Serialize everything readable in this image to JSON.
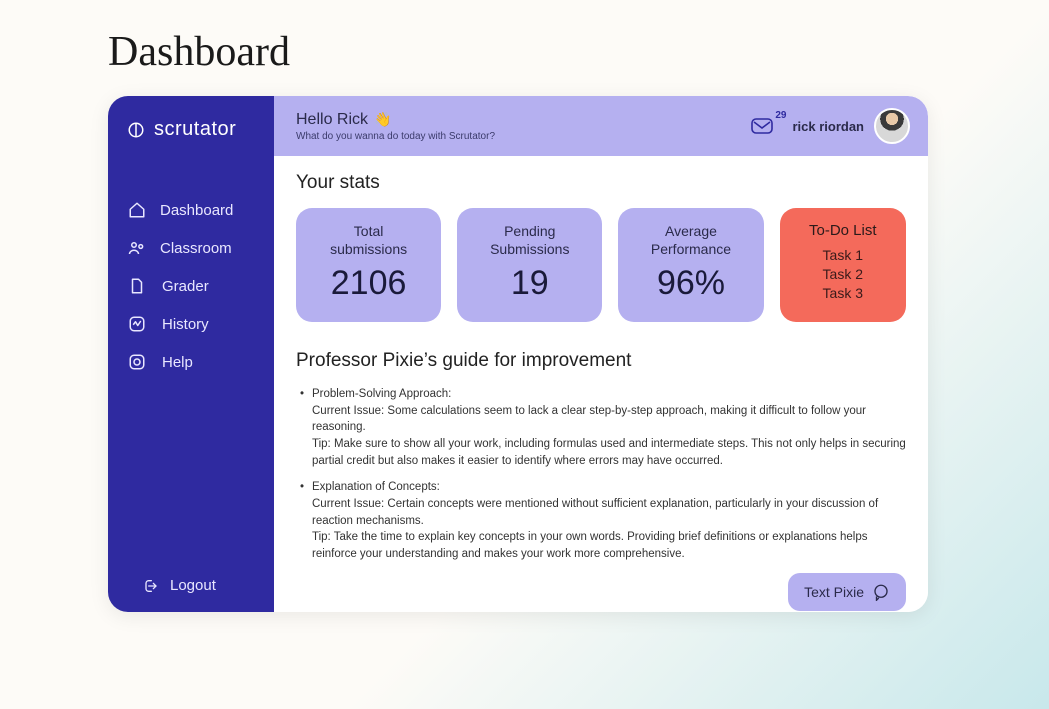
{
  "page": {
    "title": "Dashboard"
  },
  "brand": {
    "name": "scrutator"
  },
  "nav": {
    "items": [
      {
        "label": "Dashboard"
      },
      {
        "label": "Classroom"
      },
      {
        "label": "Grader"
      },
      {
        "label": "History"
      },
      {
        "label": "Help"
      }
    ],
    "logout": "Logout"
  },
  "header": {
    "greeting": "Hello Rick",
    "wave": "👋",
    "sub": "What do you wanna do today with Scrutator?",
    "inbox_count": "29",
    "username": "rick riordan"
  },
  "stats": {
    "title": "Your stats",
    "cards": [
      {
        "label_line1": "Total",
        "label_line2": "submissions",
        "value": "2106"
      },
      {
        "label_line1": "Pending",
        "label_line2": "Submissions",
        "value": "19"
      },
      {
        "label_line1": "Average",
        "label_line2": "Performance",
        "value": "96%"
      }
    ],
    "todo": {
      "title": "To-Do List",
      "items": [
        "Task 1",
        "Task 2",
        "Task 3"
      ]
    }
  },
  "guide": {
    "title": "Professor Pixie’s guide for improvement",
    "points": [
      {
        "heading": "Problem-Solving Approach:",
        "issue": "Current Issue: Some calculations seem to lack a clear step-by-step approach, making it difficult to follow your reasoning.",
        "tip": "Tip: Make sure to show all your work, including formulas used and intermediate steps. This not only helps in securing partial credit but also makes it easier to identify where errors may have occurred."
      },
      {
        "heading": "Explanation of Concepts:",
        "issue": "Current Issue: Certain concepts were mentioned without sufficient explanation, particularly in your discussion of reaction mechanisms.",
        "tip": "Tip: Take the time to explain key concepts in your own words. Providing brief definitions or explanations helps reinforce your understanding and makes your work more comprehensive."
      }
    ]
  },
  "pixie_button": "Text Pixie"
}
